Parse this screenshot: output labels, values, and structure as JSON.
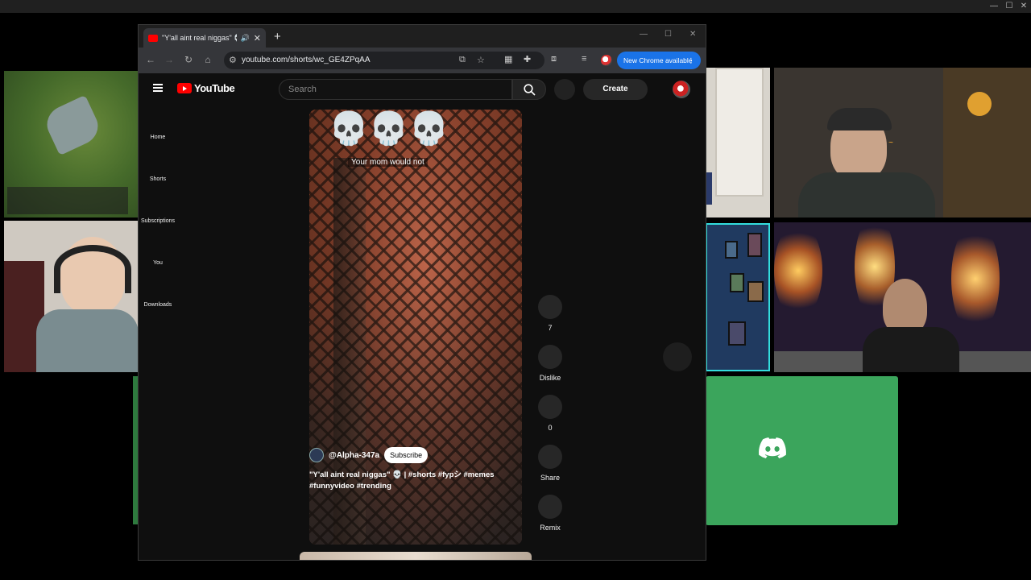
{
  "browser": {
    "tab": {
      "title": "\"Y'all aint real niggas\" 💀 | #",
      "favicon": "youtube-favicon",
      "audio_icon": "speaker-icon"
    },
    "url": "youtube.com/shorts/wc_GE4ZPqAA",
    "new_chrome_label": "New Chrome available",
    "accent_color": "#1a73e8"
  },
  "youtube": {
    "logo_text": "YouTube",
    "search_placeholder": "Search",
    "create_label": "Create",
    "sidebar": [
      {
        "label": "Home"
      },
      {
        "label": "Shorts"
      },
      {
        "label": "Subscriptions"
      },
      {
        "label": "You"
      },
      {
        "label": "Downloads"
      }
    ],
    "short": {
      "overlay_emoji": "💀💀💀",
      "caption": "Your mom would not",
      "channel": "@Alpha-347a",
      "subscribe_label": "Subscribe",
      "title": "\"Y'all aint real niggas\" 💀 | #shorts #fypシ #memes #funnyvideo #trending"
    },
    "actions": [
      {
        "label": "7",
        "icon": "like-icon"
      },
      {
        "label": "Dislike",
        "icon": "dislike-icon"
      },
      {
        "label": "0",
        "icon": "comment-icon"
      },
      {
        "label": "Share",
        "icon": "share-icon"
      },
      {
        "label": "Remix",
        "icon": "remix-icon"
      }
    ]
  },
  "call": {
    "discord_color": "#3ba55c"
  }
}
